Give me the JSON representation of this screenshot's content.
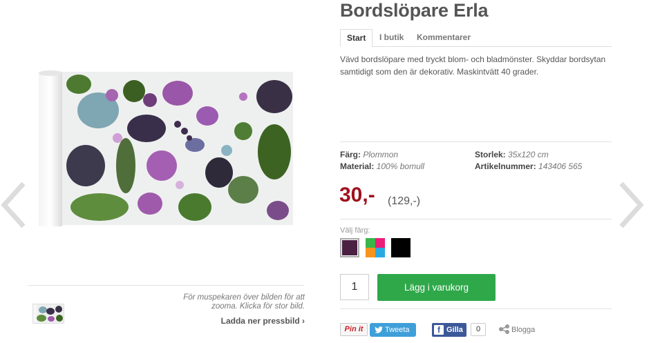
{
  "product": {
    "title": "Bordslöpare Erla",
    "tabs": [
      {
        "label": "Start",
        "active": true
      },
      {
        "label": "I butik",
        "active": false
      },
      {
        "label": "Kommentarer",
        "active": false
      }
    ],
    "description": "Vävd bordslöpare med tryckt blom- och bladmönster. Skyddar bordsytan samtidigt som den är dekorativ. Maskintvätt 40 grader.",
    "specs": {
      "color_label": "Färg:",
      "color_value": "Plommon",
      "material_label": "Material:",
      "material_value": "100% bomull",
      "size_label": "Storlek:",
      "size_value": "35x120 cm",
      "article_label": "Artikelnummer:",
      "article_value": "143406 565"
    },
    "price": "30,-",
    "original_price": "(129,-)",
    "choose_color_label": "Välj färg:",
    "swatches": [
      {
        "name": "Plommon",
        "color": "#4a2143",
        "selected": true
      },
      {
        "name": "Multi",
        "colors": [
          "#39b54a",
          "#ec1e79",
          "#f7941d",
          "#29abe2"
        ],
        "selected": false
      },
      {
        "name": "Svart",
        "color": "#000000",
        "selected": false
      }
    ],
    "quantity": "1",
    "add_to_cart_label": "Lägg i varukorg"
  },
  "image": {
    "zoom_hint": "För muspekaren över bilden för att zooma. Klicka för stor bild.",
    "press_link": "Ladda ner pressbild ›",
    "nav_prev_icon": "chevron-left-icon",
    "nav_next_icon": "chevron-right-icon"
  },
  "social": {
    "pin_label": "Pin it",
    "tweet_label": "Tweeta",
    "fb_label": "Gilla",
    "fb_count": "0",
    "blog_label": "Blogga"
  },
  "colors": {
    "price": "#a0101d",
    "add_button": "#2fa84a",
    "tweet": "#3f9fd9",
    "facebook": "#3b5998"
  }
}
